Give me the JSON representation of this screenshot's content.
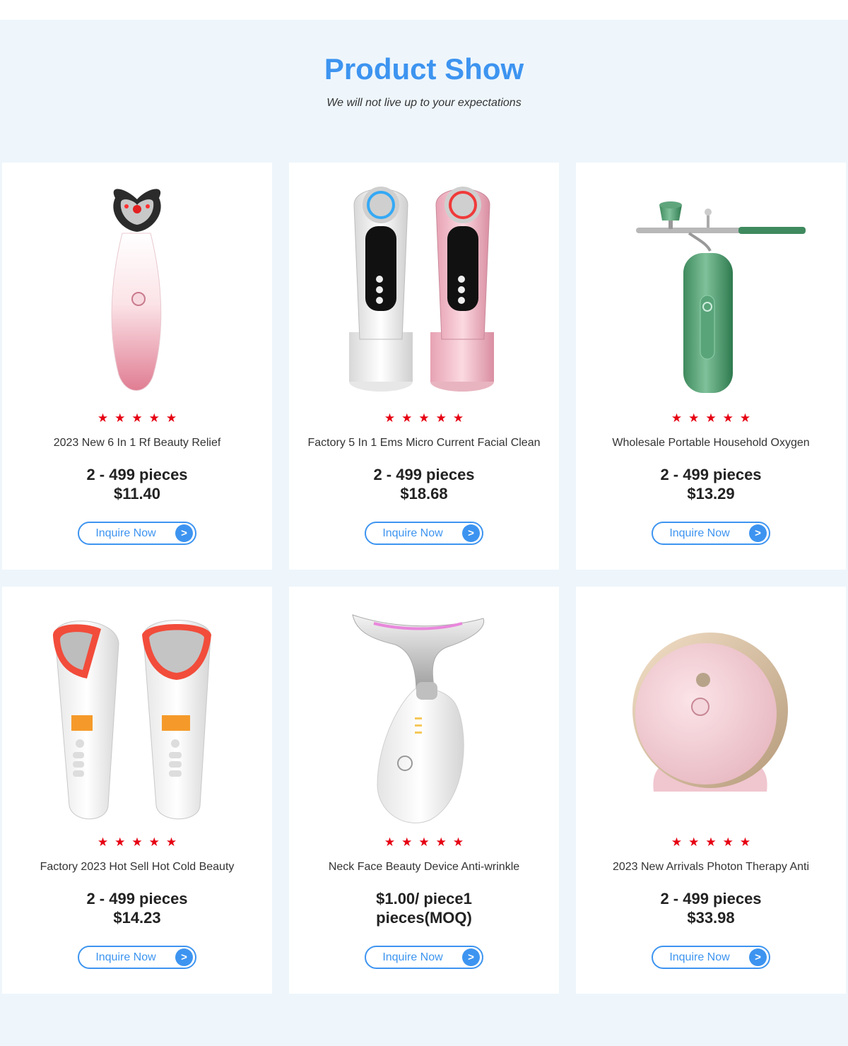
{
  "header": {
    "title": "Product Show",
    "subtitle": "We will not live up to your expectations"
  },
  "rating_stars": "★★★★★",
  "products": [
    {
      "name": "2023 New 6 In 1 Rf Beauty Relief",
      "price_line1": "2 - 499 pieces",
      "price_line2": "$11.40",
      "button": "Inquire Now",
      "button_icon": ">"
    },
    {
      "name": "Factory 5 In 1 Ems Micro Current Facial Clean",
      "price_line1": "2 - 499 pieces",
      "price_line2": "$18.68",
      "button": "Inquire Now",
      "button_icon": ">"
    },
    {
      "name": "Wholesale Portable Household Oxygen",
      "price_line1": "2 - 499 pieces",
      "price_line2": "$13.29",
      "button": "Inquire Now",
      "button_icon": ">"
    },
    {
      "name": "Factory 2023 Hot Sell Hot Cold Beauty",
      "price_line1": "2 - 499 pieces",
      "price_line2": "$14.23",
      "button": "Inquire Now",
      "button_icon": ">"
    },
    {
      "name": "Neck Face Beauty Device Anti-wrinkle",
      "price_line1": "$1.00/ piece1",
      "price_line2": "pieces(MOQ)",
      "button": "Inquire Now",
      "button_icon": ">"
    },
    {
      "name": "2023 New Arrivals Photon Therapy Anti",
      "price_line1": "2 - 499 pieces",
      "price_line2": "$33.98",
      "button": "Inquire Now",
      "button_icon": ">"
    }
  ],
  "colors": {
    "accent": "#3d94f0",
    "star": "#e60012",
    "section_bg": "#eef6fc"
  }
}
